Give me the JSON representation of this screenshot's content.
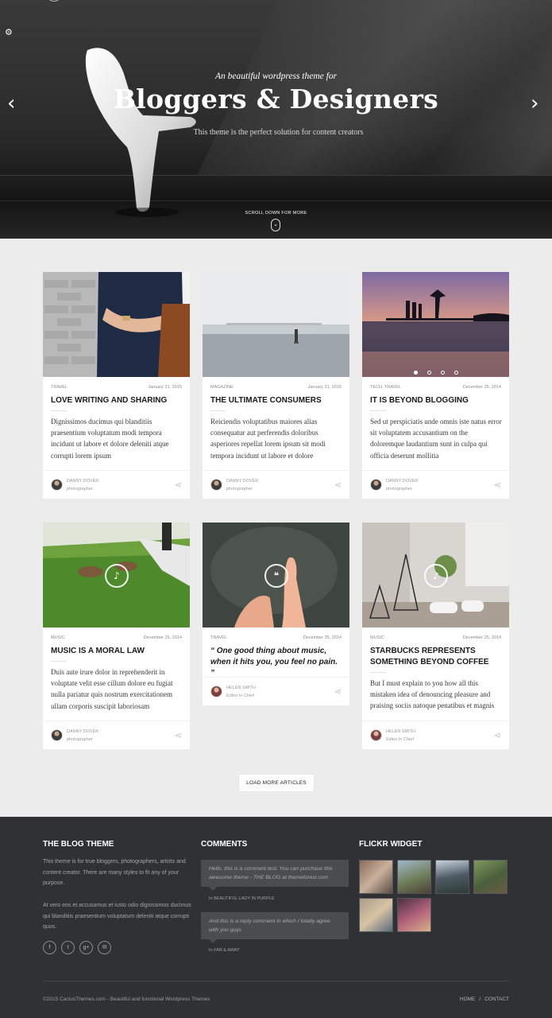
{
  "hero": {
    "kicker": "An beautiful wordpress theme for",
    "title": "Bloggers & Designers",
    "subtitle": "This theme is the perfect solution for content creators",
    "scroll_label": "SCROLL DOWN FOR MORE",
    "prev_icon": "chevron-left-icon",
    "next_icon": "chevron-right-icon",
    "settings_icon": "gear-icon"
  },
  "posts": [
    {
      "category": "TRAVEL",
      "date": "January 21, 2015",
      "title": "LOVE WRITING AND SHARING",
      "excerpt": "Dignissimos ducimus qui blanditiis praesentium voluptatum modi tempora incidunt ut labore et dolore deleniti atque corrupti lorem ipsum",
      "author": "DANNY DOVER",
      "role": "photographer"
    },
    {
      "category": "MAGAZINE",
      "date": "January 21, 2015",
      "title": "THE ULTIMATE CONSUMERS",
      "excerpt": "Reiciendis voluptatibus maiores alias consequatur aut perferendis doloribus asperiores repellat lorem ipsum sit modi tempora incidunt ut labore et dolore",
      "author": "DANNY DOVER",
      "role": "photographer"
    },
    {
      "category": "TECH, TRAVEL",
      "date": "December 25, 2014",
      "title": "IT IS BEYOND BLOGGING",
      "excerpt": "Sed ut perspiciatis unde omnis iste natus error sit voluptatem accusantium on the doloremque laudantium sunt in culpa qui officia deserunt mollitia",
      "author": "DANNY DOVER",
      "role": "photographer"
    },
    {
      "category": "MUSIC",
      "date": "December 25, 2014",
      "title": "MUSIC IS A MORAL LAW",
      "excerpt": "Duis aute irure dolor in reprehenderit in voluptate velit esse cillum dolore eu fugiat nulla pariatur quis nostrum exercitationem ullam corporis suscipit laboriosam",
      "author": "DANNY DOVER",
      "role": "photographer"
    },
    {
      "category": "TRAVEL",
      "date": "December 25, 2014",
      "title": "“ One good thing about music, when it hits you, you feel no pain. ”",
      "excerpt": "",
      "author": "HELEN SMITH",
      "role": "Editor In Chief"
    },
    {
      "category": "MUSIC",
      "date": "December 25, 2014",
      "title": "STARBUCKS REPRESENTS SOMETHING BEYOND COFFEE",
      "excerpt": "But I must explain to you how all this mistaken idea of denouncing pleasure and praising sociis natoque penatibus et magnis",
      "author": "HELEN SMITH",
      "role": "Editor In Chief"
    }
  ],
  "load_more_label": "LOAD MORE ARTICLES",
  "footer": {
    "about_title": "THE BLOG THEME",
    "about_p1": "This theme is for true bloggers, photographers, artists and content creator. There are many styles to fit any of your purpose.",
    "about_p2": "At vero eos et accusamus et iusto odio dignissimos ducimus qui blanditiis praesentium voluptatum deleniti atque corrupti quos.",
    "social": [
      "f",
      "t",
      "g+",
      "✉"
    ],
    "comments_title": "COMMENTS",
    "comments": [
      {
        "text": "Hello, this is a comment test. You can purchase this awesome theme - THE BLOG at themeforest.com",
        "ref": "In BEAUTIFUL LADY IN PURPLE"
      },
      {
        "text": "And this is a reply comment in which I totally agree with you guys",
        "ref": "In FAR & AWAY"
      }
    ],
    "flickr_title": "FLICKR WIDGET",
    "copyright": "©2015 CactusThemes.com - Beautiful and functional Wordpress Themes",
    "nav": {
      "home": "HOME",
      "sep": "/",
      "contact": "CONTACT"
    }
  }
}
